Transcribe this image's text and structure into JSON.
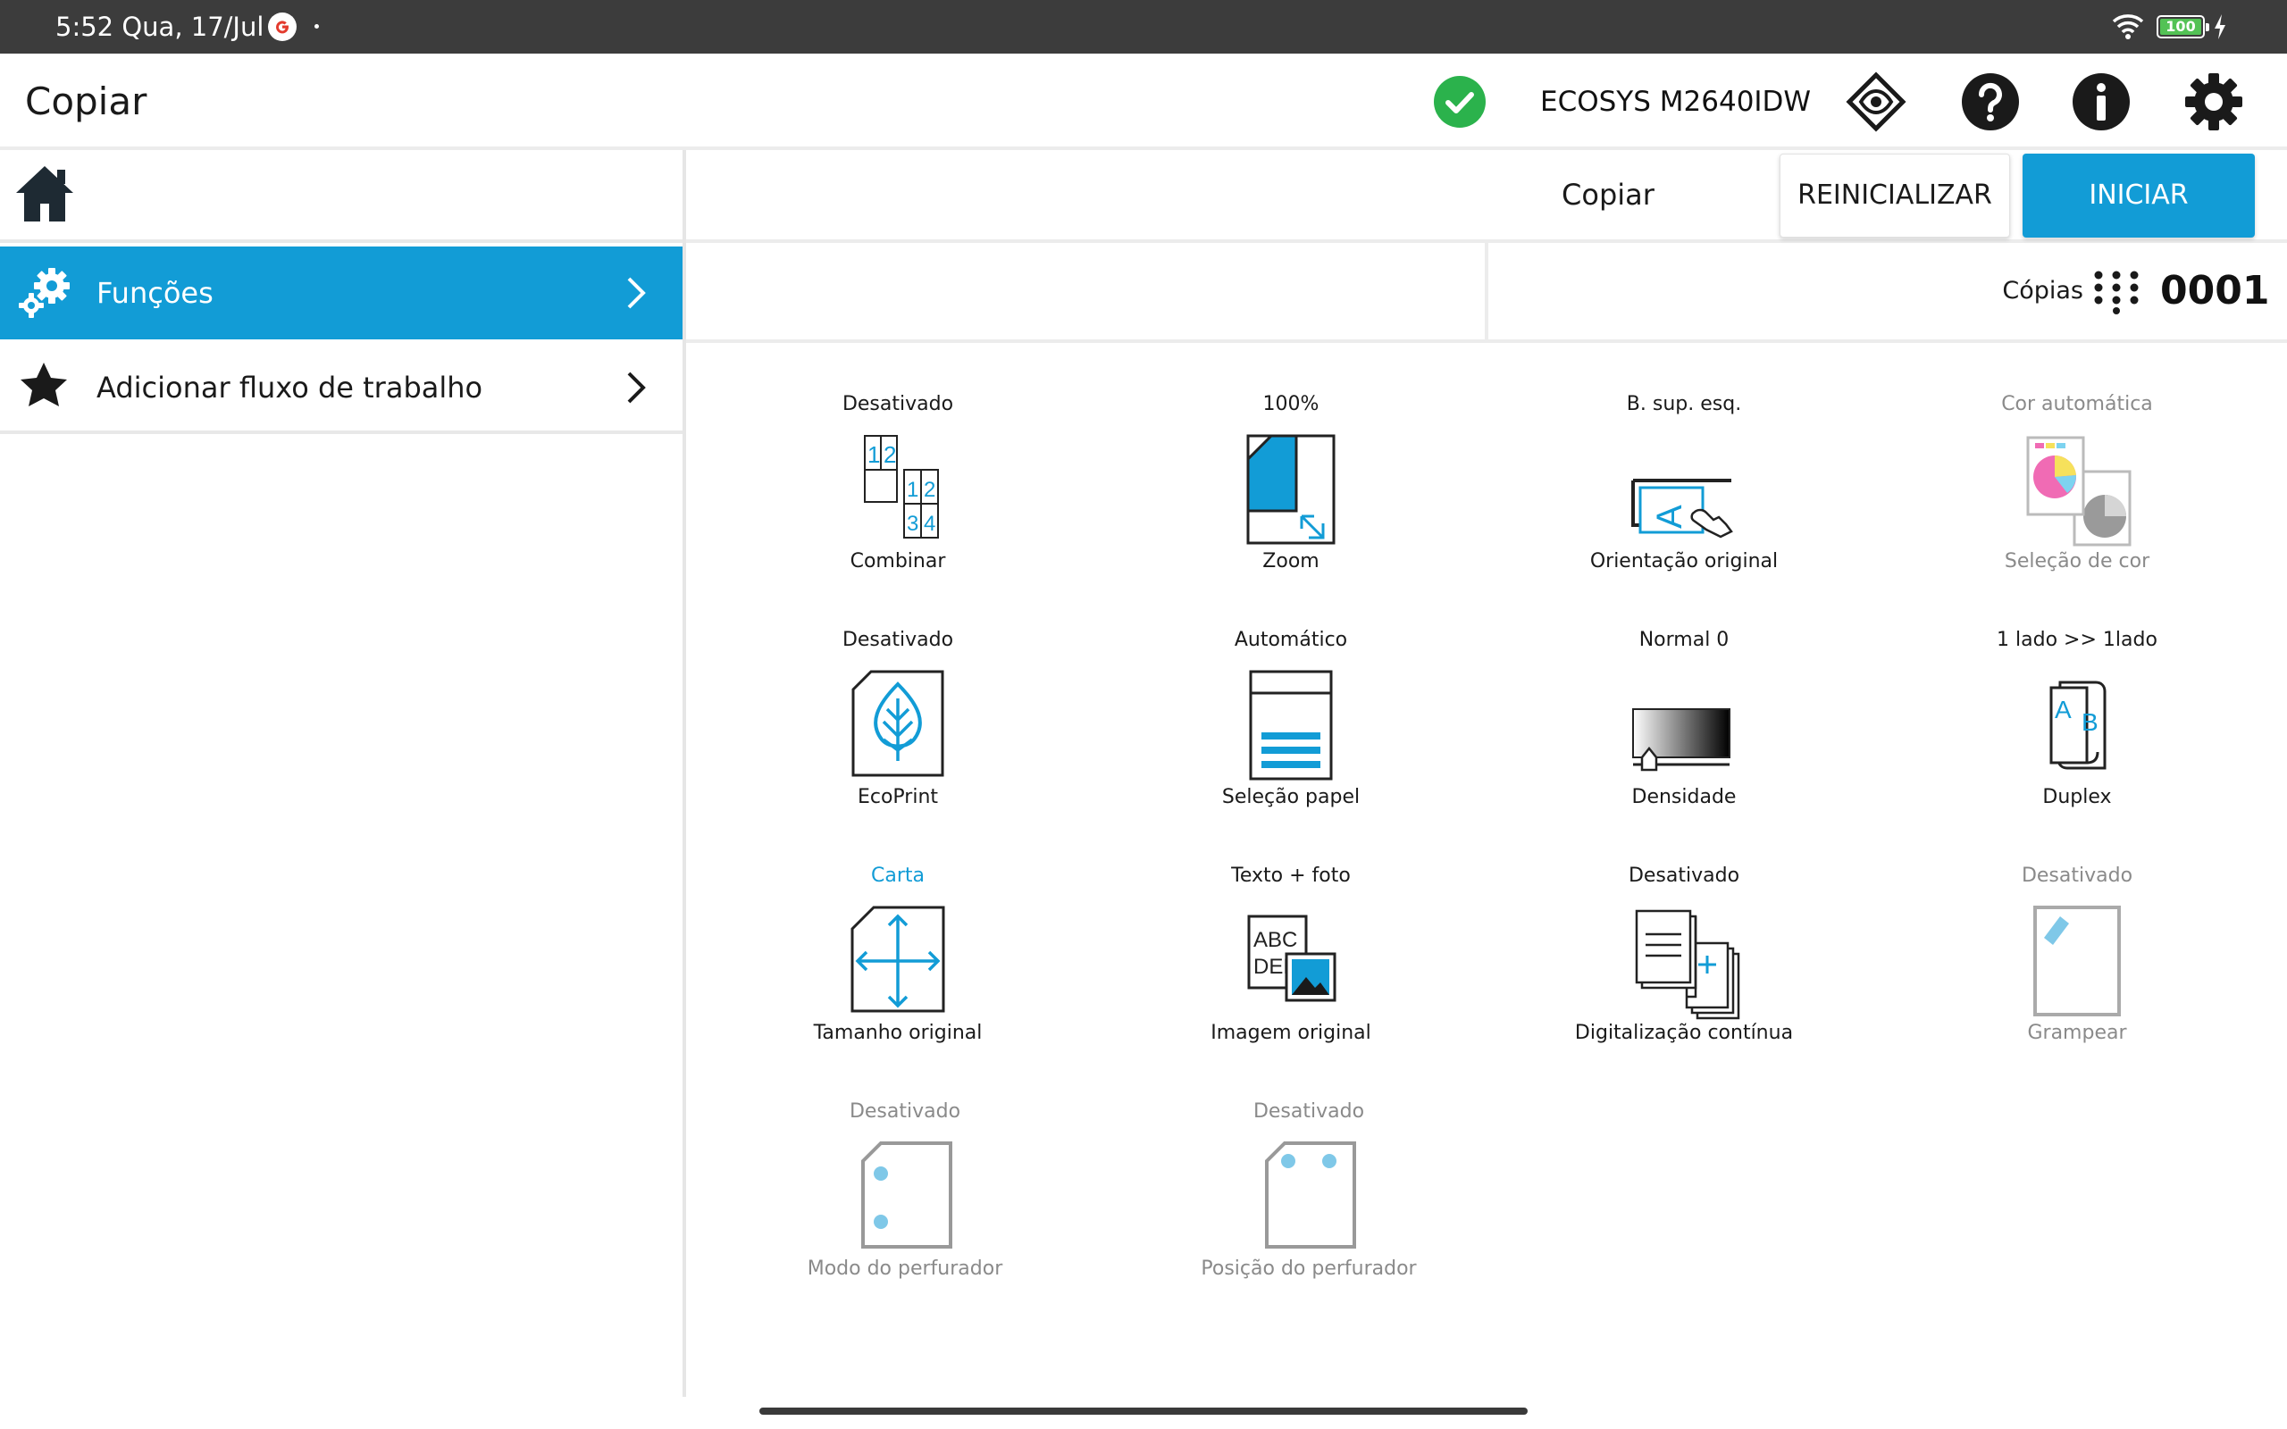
{
  "status_bar": {
    "time": "5:52 Qua, 17/Jul",
    "battery_level": "100"
  },
  "app_bar": {
    "title": "Copiar",
    "device_model": "ECOSYS M2640IDW"
  },
  "sidebar": {
    "items": [
      {
        "label": "Funções",
        "active": true
      },
      {
        "label": "Adicionar fluxo de trabalho",
        "active": false
      }
    ]
  },
  "header": {
    "title": "Copiar",
    "reset_label": "REINICIALIZAR",
    "start_label": "INICIAR"
  },
  "copies": {
    "label": "Cópias",
    "count": "0001"
  },
  "functions": [
    {
      "value": "Desativado",
      "name": "Combinar",
      "icon": "combine-icon",
      "enabled": true
    },
    {
      "value": "100%",
      "name": "Zoom",
      "icon": "zoom-icon",
      "enabled": true
    },
    {
      "value": "B. sup. esq.",
      "name": "Orientação original",
      "icon": "orientation-icon",
      "enabled": true
    },
    {
      "value": "Cor automática",
      "name": "Seleção de cor",
      "icon": "color-selection-icon",
      "enabled": false
    },
    {
      "value": "Desativado",
      "name": "EcoPrint",
      "icon": "ecoprint-icon",
      "enabled": true
    },
    {
      "value": "Automático",
      "name": "Seleção papel",
      "icon": "paper-selection-icon",
      "enabled": true
    },
    {
      "value": "Normal 0",
      "name": "Densidade",
      "icon": "density-icon",
      "enabled": true
    },
    {
      "value": "1 lado >> 1lado",
      "name": "Duplex",
      "icon": "duplex-icon",
      "enabled": true
    },
    {
      "value": "Carta",
      "name": "Tamanho original",
      "icon": "original-size-icon",
      "enabled": true
    },
    {
      "value": "Texto + foto",
      "name": "Imagem original",
      "icon": "original-image-icon",
      "enabled": true
    },
    {
      "value": "Desativado",
      "name": "Digitalização contínua",
      "icon": "continuous-scan-icon",
      "enabled": true
    },
    {
      "value": "Desativado",
      "name": "Grampear",
      "icon": "staple-icon",
      "enabled": false
    },
    {
      "value": "Desativado",
      "name": "Modo do perfurador",
      "icon": "punch-mode-icon",
      "enabled": false
    },
    {
      "value": "Desativado",
      "name": "Posição do perfurador",
      "icon": "punch-position-icon",
      "enabled": false
    }
  ],
  "colors": {
    "accent": "#129cd6",
    "status_ok": "#2bb24c",
    "disabled_text": "#8a8a8a"
  }
}
